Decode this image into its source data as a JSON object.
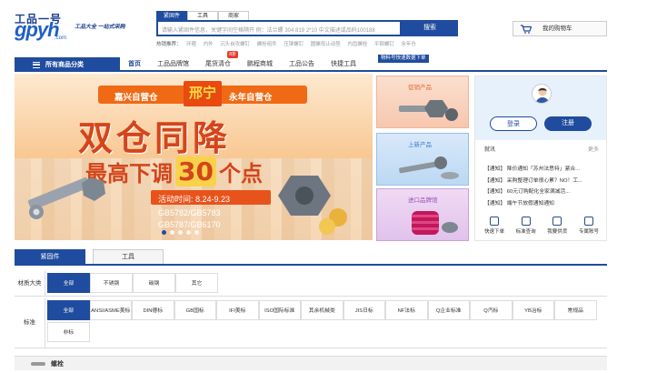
{
  "header": {
    "logo_top": "工品一号",
    "logo_main": "gpyh",
    "logo_sub": ".com",
    "slogan": "工品大全 一站式采购",
    "search_tabs": [
      "紧固件",
      "工具",
      "商家"
    ],
    "search_placeholder": "请输入紧固件信息，关键字间空格隔开 例：法兰螺 304 819 2*10 中文描述或品码100188",
    "search_button": "搜索",
    "hot_label": "热销推荐：",
    "hot_terms": [
      "环箍",
      "内外",
      "沉头自攻螺钉",
      "螺栓组件",
      "压铆螺钉",
      "圆螺母止动垫",
      "内齿螺栓",
      "平铆螺钉",
      "永年仓"
    ],
    "cart_label": "我的购物车"
  },
  "nav": {
    "all_categories": "所有商品分类",
    "items": [
      "首页",
      "工品品牌馆",
      "尾货清仓",
      "鹏程商城",
      "工品公告",
      "快捷工具"
    ],
    "badge": "8折",
    "promo_tag": "物料号快速数据下单"
  },
  "banner": {
    "left_wh": "嘉兴自营仓",
    "mid_wh": "邢宁",
    "right_wh": "永年自营仓",
    "headline": "双仓同降",
    "sub_pre": "最高下调",
    "sub_num": "30",
    "sub_post": "个点",
    "activity": "活动时间: 8.24-9.23",
    "gb_lines": [
      "GB5782/GB5783",
      "GB5787/GB6170"
    ]
  },
  "side_panels": [
    "促销产品",
    "上新产品",
    "进口品牌馆"
  ],
  "user": {
    "login": "登录",
    "register": "注册",
    "notice_title": "就讯",
    "more": "更多",
    "notices": [
      "【通知】 降价通知「苏州法思特」紧合...",
      "【通知】 采购整理订单很心累？NO！工...",
      "【通知】 60元订购配化全家满减活...",
      "【通知】 端午节放假通知通知"
    ],
    "quick": [
      "快速下单",
      "标准查询",
      "我要供货",
      "专属账号"
    ]
  },
  "filter": {
    "tabs": [
      "紧固件",
      "工具"
    ],
    "material_label": "材质大类",
    "materials": [
      "全部",
      "不锈钢",
      "碳钢",
      "其它"
    ],
    "standard_label": "标准",
    "standards": [
      "全部",
      "ANSI/ASME美标",
      "DIN德标",
      "GB国标",
      "IFI美标",
      "ISO国际标准",
      "其余机械类",
      "JIS日标",
      "NF法标",
      "Q企业标准",
      "Q汽标",
      "YB冶标",
      "常规品",
      "非标"
    ],
    "bottom_label": "螺栓"
  }
}
